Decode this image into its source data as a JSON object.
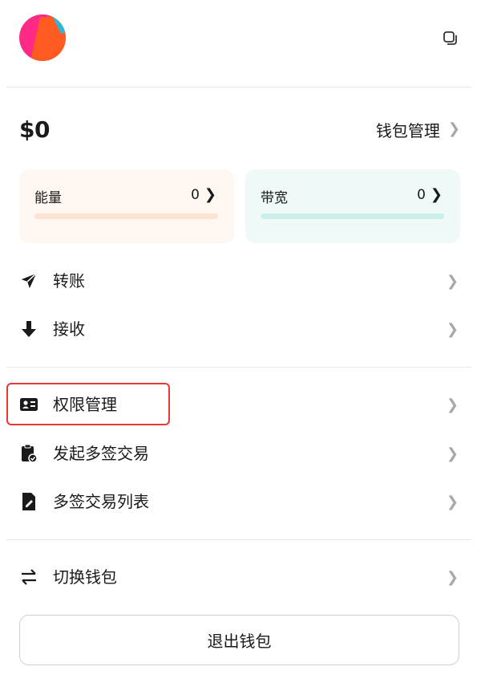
{
  "account": {
    "balance": "$0",
    "wallet_management_label": "钱包管理"
  },
  "resources": {
    "energy": {
      "label": "能量",
      "value": "0"
    },
    "bandwidth": {
      "label": "带宽",
      "value": "0"
    }
  },
  "menu": {
    "transfer": {
      "label": "转账",
      "icon": "paper-plane-icon"
    },
    "receive": {
      "label": "接收",
      "icon": "arrow-down-icon"
    },
    "permission_management": {
      "label": "权限管理",
      "icon": "id-card-icon"
    },
    "initiate_multisig": {
      "label": "发起多签交易",
      "icon": "clipboard-check-icon"
    },
    "multisig_list": {
      "label": "多签交易列表",
      "icon": "file-edit-icon"
    },
    "switch_wallet": {
      "label": "切换钱包",
      "icon": "swap-arrows-icon"
    }
  },
  "logout_label": "退出钱包",
  "colors": {
    "highlight": "#e53935",
    "energy_bg": "#fff8f2",
    "bandwidth_bg": "#eef9f8"
  }
}
